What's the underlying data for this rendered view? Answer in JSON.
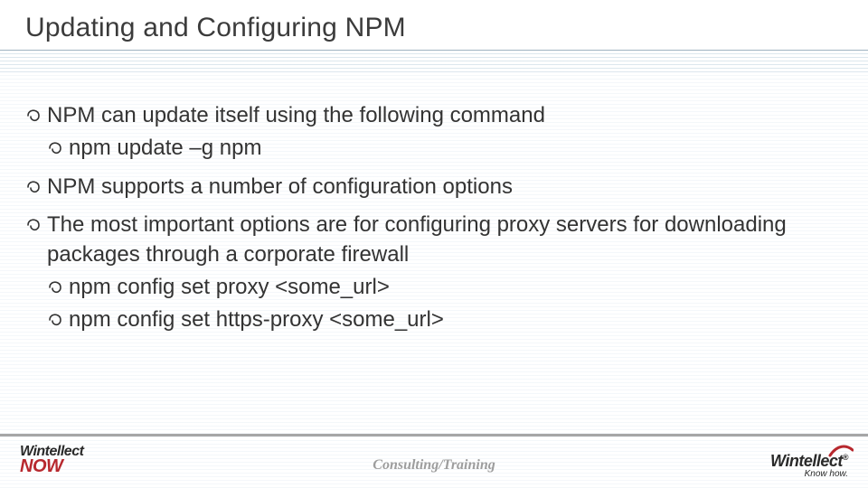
{
  "title": "Updating and Configuring NPM",
  "bullets": {
    "b1": "NPM can update itself using the following command",
    "b1a": "npm update –g npm",
    "b2": "NPM supports a number of configuration options",
    "b3": "The most important options are for configuring proxy servers for downloading packages through a corporate firewall",
    "b3a": "npm config set proxy <some_url>",
    "b3b": "npm config set https-proxy <some_url>"
  },
  "footer": {
    "left_top": "Wintellect",
    "left_bottom": "NOW",
    "center": "Consulting/Training",
    "right_brand": "Wintellect",
    "right_reg": "®",
    "right_tag": "Know how."
  }
}
